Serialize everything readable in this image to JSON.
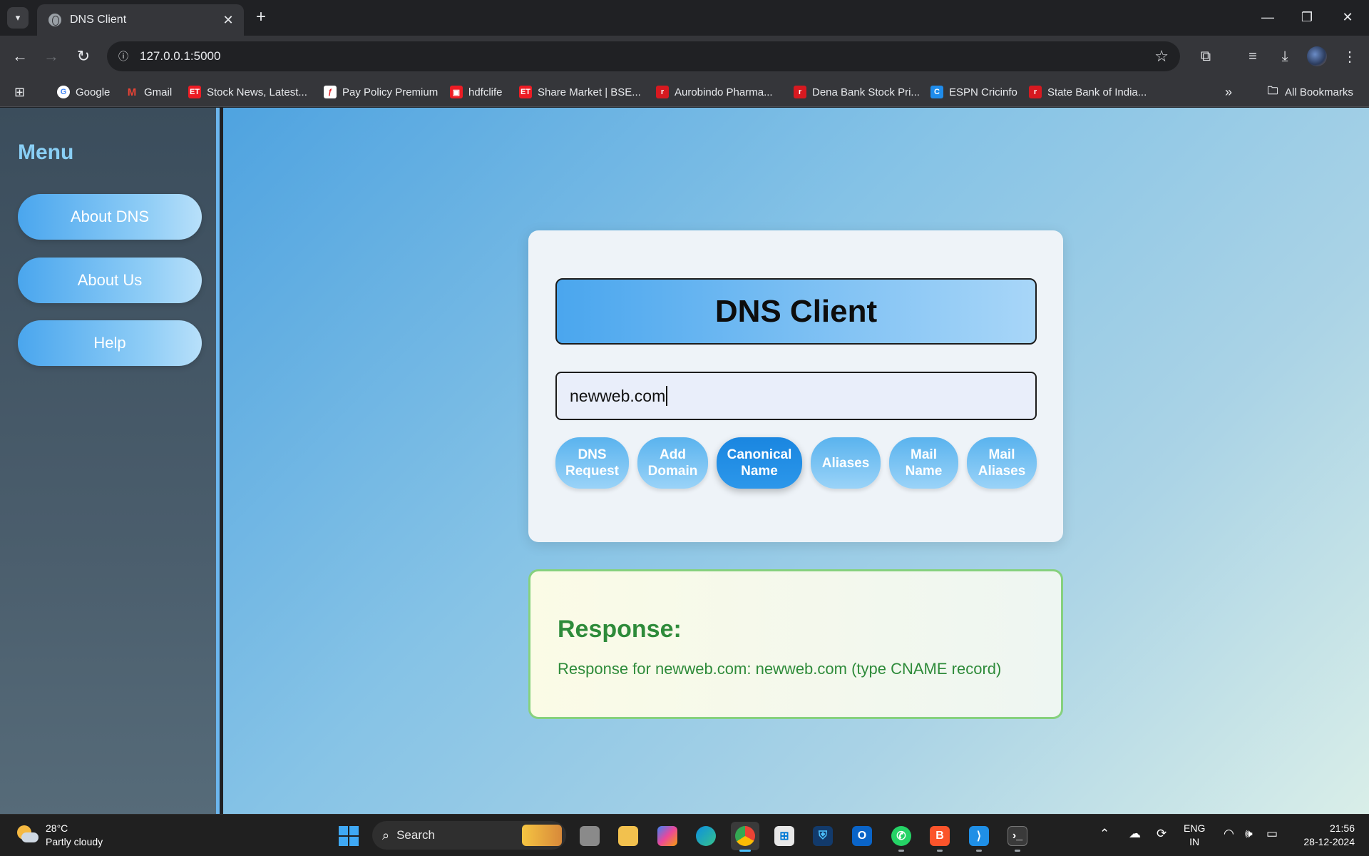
{
  "browser": {
    "tab_title": "DNS Client",
    "url": "127.0.0.1:5000",
    "bookmarks": [
      {
        "label": "Google",
        "icon": "google-icon",
        "color": "#ffffff"
      },
      {
        "label": "Gmail",
        "icon": "gmail-icon",
        "color": "#ea4335"
      },
      {
        "label": "Stock News, Latest...",
        "icon": "et-icon",
        "color": "#ed1c24"
      },
      {
        "label": "Pay Policy Premium",
        "icon": "hdfc-life-icon",
        "color": "#e31e24"
      },
      {
        "label": "hdfclife",
        "icon": "hdfclife-icon",
        "color": "#ed1c24"
      },
      {
        "label": "Share Market | BSE...",
        "icon": "et-icon",
        "color": "#ed1c24"
      },
      {
        "label": "Aurobindo Pharma...",
        "icon": "rediff-icon",
        "color": "#d71920"
      },
      {
        "label": "Dena Bank Stock Pri...",
        "icon": "rediff-icon",
        "color": "#d71920"
      },
      {
        "label": "ESPN Cricinfo",
        "icon": "cricinfo-icon",
        "color": "#1f8ceb"
      },
      {
        "label": "State Bank of India...",
        "icon": "rediff-icon",
        "color": "#d71920"
      }
    ],
    "all_bookmarks": "All Bookmarks"
  },
  "sidebar": {
    "title": "Menu",
    "items": [
      {
        "label": "About DNS"
      },
      {
        "label": "About Us"
      },
      {
        "label": "Help"
      }
    ]
  },
  "client": {
    "title": "DNS Client",
    "input_value": "newweb.com",
    "buttons": [
      {
        "line1": "DNS",
        "line2": "Request"
      },
      {
        "line1": "Add",
        "line2": "Domain"
      },
      {
        "line1": "Canonical",
        "line2": "Name"
      },
      {
        "line1": "Aliases",
        "line2": ""
      },
      {
        "line1": "Mail",
        "line2": "Name"
      },
      {
        "line1": "Mail",
        "line2": "Aliases"
      }
    ],
    "active_button": "Canonical Name"
  },
  "response": {
    "title": "Response:",
    "text": "Response for newweb.com: newweb.com (type CNAME record)"
  },
  "taskbar": {
    "weather_temp": "28°C",
    "weather_desc": "Partly cloudy",
    "search_placeholder": "Search",
    "lang_line1": "ENG",
    "lang_line2": "IN",
    "time": "21:56",
    "date": "28-12-2024"
  },
  "colors": {
    "accent": "#4aa6ee",
    "active_button": "#1a86e0",
    "response_text": "#2e8b3a",
    "response_border": "#86d17e"
  }
}
